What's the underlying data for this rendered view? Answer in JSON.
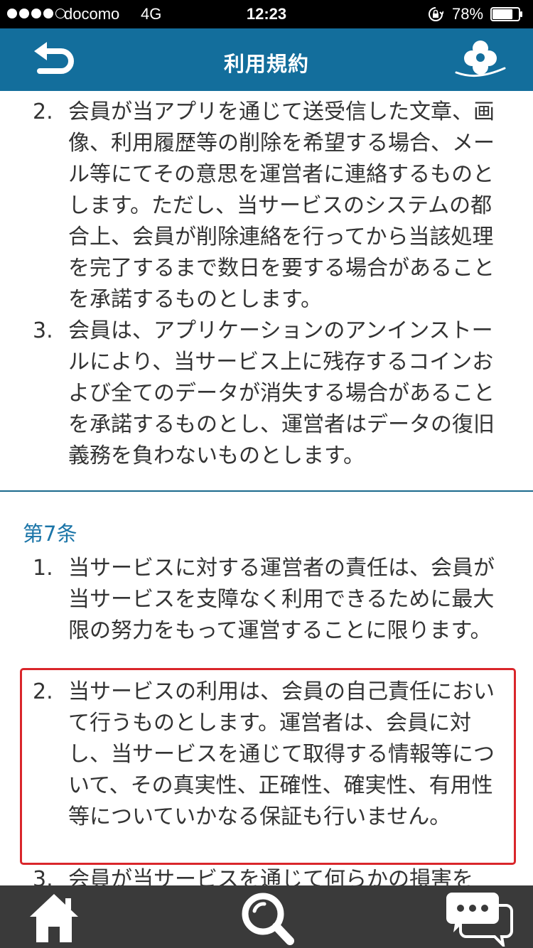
{
  "status_bar": {
    "carrier": "docomo",
    "network": "4G",
    "time": "12:23",
    "battery": "78%",
    "battery_level": 0.78,
    "signal_bars_filled": 4,
    "signal_bars_total": 5
  },
  "nav": {
    "title": "利用規約",
    "back_icon": "back-arrow-icon",
    "right_icon": "clover-icon"
  },
  "content": {
    "prev_items": [
      {
        "number": "2.",
        "text": "会員が当アプリを通じて送受信した文章、画像、利用履歴等の削除を希望する場合、メール等にてその意思を運営者に連絡するものとします。ただし、当サービスのシステムの都合上、会員が削除連絡を行ってから当該処理を完了するまで数日を要する場合があることを承諾するものとします。"
      },
      {
        "number": "3.",
        "text": "会員は、アプリケーションのアンインストールにより、当サービス上に残存するコインおよび全てのデータが消失する場合があることを承諾するものとし、運営者はデータの復旧義務を負わないものとします。"
      }
    ],
    "article": {
      "heading": "第7条",
      "items": [
        {
          "number": "1.",
          "text": "当サービスに対する運営者の責任は、会員が当サービスを支障なく利用できるために最大限の努力をもって運営することに限ります。"
        },
        {
          "number": "2.",
          "text": "当サービスの利用は、会員の自己責任において行うものとします。運営者は、会員に対し、当サービスを通じて取得する情報等について、その真実性、正確性、確実性、有用性等についていかなる保証も行いません。"
        },
        {
          "number": "3.",
          "text": "会員が当サービスを通じて何らかの損害を"
        }
      ]
    },
    "highlight_color": "#d9262b",
    "heading_color": "#1b75a8"
  },
  "tab_bar": {
    "items": [
      {
        "icon": "home-icon"
      },
      {
        "icon": "search-icon"
      },
      {
        "icon": "chat-icon"
      }
    ]
  },
  "colors": {
    "nav_background": "#136e9c",
    "tab_background": "#3a3a3a",
    "status_background": "#000000"
  }
}
